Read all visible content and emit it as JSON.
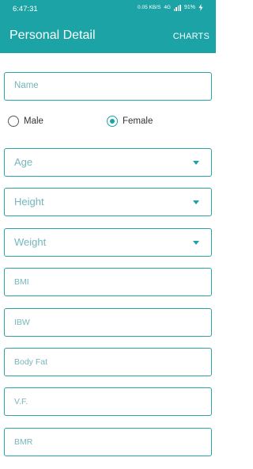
{
  "status_bar": {
    "time": "6:47:31",
    "data_speed": "0.05 KB/S",
    "network": "4G",
    "battery": "91%"
  },
  "app_bar": {
    "title": "Personal Detail",
    "action": "CHARTS"
  },
  "form": {
    "name_placeholder": "Name",
    "gender": {
      "options": [
        "Male",
        "Female"
      ],
      "selected": "Female"
    },
    "age_label": "Age",
    "height_label": "Height",
    "weight_label": "Weight",
    "bmi_label": "BMI",
    "ibw_label": "IBW",
    "body_fat_label": "Body Fat",
    "vf_label": "V.F.",
    "bmr_label": "BMR"
  },
  "colors": {
    "accent": "#1ba3a6",
    "field_border": "#2aa3a3",
    "field_text": "#75b6bb"
  }
}
